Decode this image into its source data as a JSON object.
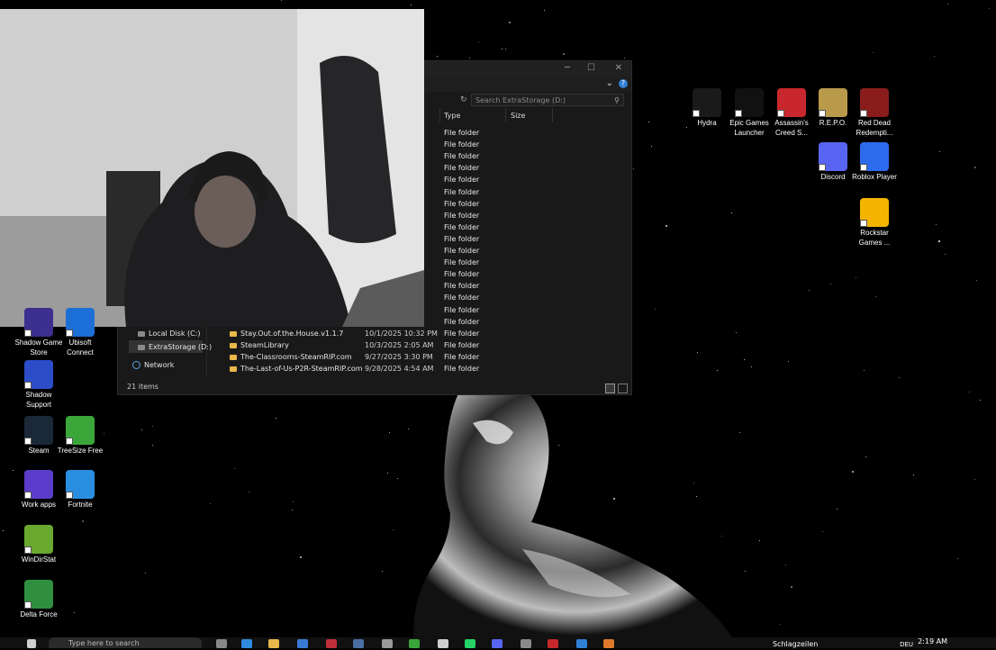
{
  "explorer": {
    "search_placeholder": "Search ExtraStorage (D:)",
    "columns": {
      "type": "Type",
      "size": "Size"
    },
    "type_cells": [
      "File folder",
      "File folder",
      "File folder",
      "File folder",
      "File folder",
      "File folder",
      "File folder",
      "File folder",
      "File folder",
      "File folder",
      "File folder",
      "File folder",
      "File folder",
      "File folder",
      "File folder",
      "File folder",
      "File folder",
      "File folder",
      "File folder",
      "File folder",
      "File folder"
    ],
    "nav": [
      {
        "label": "Local Disk (C:)"
      },
      {
        "label": "ExtraStorage (D:)"
      },
      {
        "label": "Network"
      }
    ],
    "files": [
      {
        "name": "Stay.Out.of.the.House.v1.1.7",
        "date": "10/1/2025 10:32 PM"
      },
      {
        "name": "SteamLibrary",
        "date": "10/3/2025 2:05 AM"
      },
      {
        "name": "The-Classrooms-SteamRIP.com",
        "date": "9/27/2025 3:30 PM"
      },
      {
        "name": "The-Last-of-Us-P2R-SteamRIP.com",
        "date": "9/28/2025 4:54 AM"
      }
    ],
    "status": "21 items"
  },
  "desktop_right": [
    {
      "label": "Hydra",
      "icon": "hydra-icon",
      "color": "#1a1a1a"
    },
    {
      "label": "Epic Games Launcher",
      "icon": "epic-games-icon",
      "color": "#111111"
    },
    {
      "label": "Assassin's Creed S...",
      "icon": "assassins-creed-icon",
      "color": "#c8282d"
    },
    {
      "label": "R.E.P.O.",
      "icon": "repo-icon",
      "color": "#b89a4a"
    },
    {
      "label": "Red Dead Redempti...",
      "icon": "red-dead-icon",
      "color": "#8b1c1c"
    },
    {
      "label": "Discord",
      "icon": "discord-icon",
      "color": "#5865f2"
    },
    {
      "label": "Roblox Player",
      "icon": "roblox-icon",
      "color": "#2c6bed"
    },
    {
      "label": "Rockstar Games ...",
      "icon": "rockstar-icon",
      "color": "#f4b400"
    }
  ],
  "desktop_left": [
    {
      "label": "Shadow Game Store",
      "icon": "shadow-store-icon",
      "color": "#3c2f8f"
    },
    {
      "label": "Ubisoft Connect",
      "icon": "ubisoft-icon",
      "color": "#1c6fd6"
    },
    {
      "label": "Shadow Support",
      "icon": "shadow-support-icon",
      "color": "#2c4cc8"
    },
    {
      "label": "Steam",
      "icon": "steam-icon",
      "color": "#1b2838"
    },
    {
      "label": "TreeSize Free",
      "icon": "treesize-icon",
      "color": "#3aa63a"
    },
    {
      "label": "Work apps",
      "icon": "work-apps-icon",
      "color": "#5a3ecb"
    },
    {
      "label": "Fortnite",
      "icon": "fortnite-icon",
      "color": "#2a8ee0"
    },
    {
      "label": "WinDirStat",
      "icon": "windirstat-icon",
      "color": "#6aa830"
    },
    {
      "label": "Delta Force",
      "icon": "delta-force-icon",
      "color": "#2f8f3f"
    }
  ],
  "taskbar": {
    "search_placeholder": "Type here to search",
    "news": "Schlagzeilen",
    "lang": "DEU",
    "time": "2:19 AM"
  }
}
